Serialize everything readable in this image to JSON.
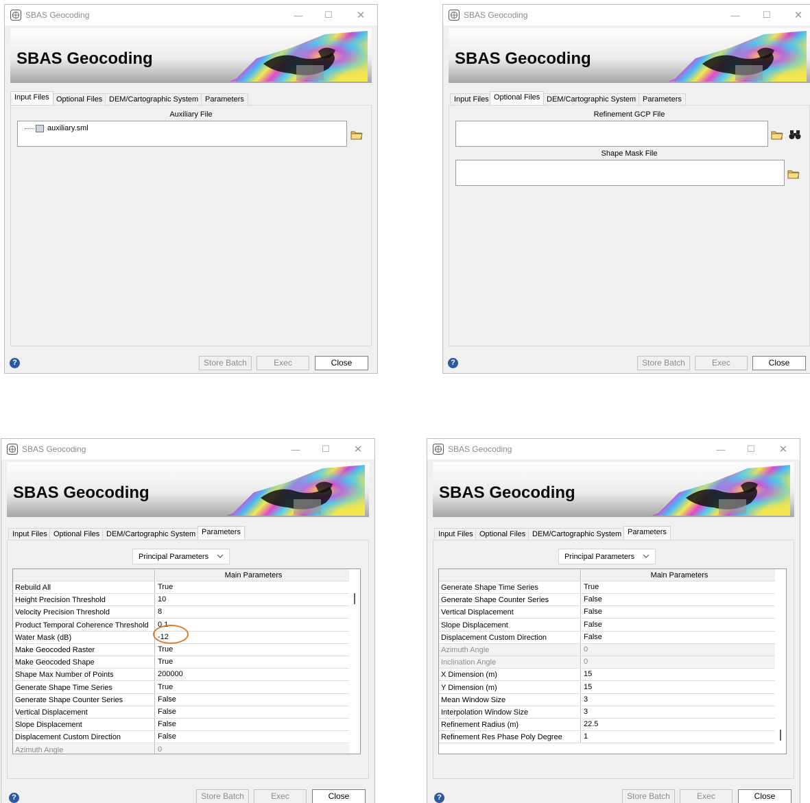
{
  "app_title": "SBAS Geocoding",
  "banner_title": "SBAS Geocoding",
  "window_controls": {
    "minimize": "—",
    "maximize": "☐",
    "close": "✕"
  },
  "tabs": [
    "Input Files",
    "Optional Files",
    "DEM/Cartographic System",
    "Parameters"
  ],
  "buttons": {
    "store_batch": "Store Batch",
    "exec": "Exec",
    "close": "Close",
    "help": "?"
  },
  "icons": {
    "app": "sbas-app-icon",
    "folder": "open-folder-icon",
    "binoculars": "binoculars-icon",
    "file": "file-icon",
    "combo": "chevron-down-icon"
  },
  "colors": {
    "highlight_circle": "#e07b2a",
    "help_icon": "#2b5aa3"
  },
  "input_files": {
    "section_label": "Auxiliary File",
    "file_name": "auxiliary.sml"
  },
  "optional_files": {
    "gcp_label": "Refinement GCP File",
    "mask_label": "Shape Mask File"
  },
  "parameters": {
    "combo_value": "Principal Parameters",
    "table_header": "Main Parameters",
    "rows_top": [
      {
        "name": "Rebuild All",
        "value": "True"
      },
      {
        "name": "Height Precision Threshold",
        "value": "10"
      },
      {
        "name": "Velocity Precision Threshold",
        "value": "8"
      },
      {
        "name": "Product Temporal Coherence Threshold",
        "value": "0.1"
      },
      {
        "name": "Water Mask (dB)",
        "value": "-12"
      },
      {
        "name": "Make Geocoded Raster",
        "value": "True"
      },
      {
        "name": "Make Geocoded Shape",
        "value": "True"
      },
      {
        "name": "Shape Max Number of Points",
        "value": "200000"
      },
      {
        "name": "Generate Shape Time Series",
        "value": "True"
      },
      {
        "name": "Generate Shape Counter Series",
        "value": "False"
      },
      {
        "name": "Vertical Displacement",
        "value": "False"
      },
      {
        "name": "Slope Displacement",
        "value": "False"
      },
      {
        "name": "Displacement Custom Direction",
        "value": "False"
      },
      {
        "name": "Azimuth Angle",
        "value": "0",
        "disabled": true
      }
    ],
    "rows_bottom": [
      {
        "name": "Generate Shape Time Series",
        "value": "True"
      },
      {
        "name": "Generate Shape Counter Series",
        "value": "False"
      },
      {
        "name": "Vertical Displacement",
        "value": "False"
      },
      {
        "name": "Slope Displacement",
        "value": "False"
      },
      {
        "name": "Displacement Custom Direction",
        "value": "False"
      },
      {
        "name": "Azimuth Angle",
        "value": "0",
        "disabled": true
      },
      {
        "name": "Inclination Angle",
        "value": "0",
        "disabled": true
      },
      {
        "name": "X Dimension (m)",
        "value": "15"
      },
      {
        "name": "Y Dimension (m)",
        "value": "15"
      },
      {
        "name": "Mean Window Size",
        "value": "3"
      },
      {
        "name": "Interpolation Window Size",
        "value": "3"
      },
      {
        "name": "Refinement Radius (m)",
        "value": "22.5"
      },
      {
        "name": "Refinement Res Phase Poly Degree",
        "value": "1"
      }
    ]
  }
}
